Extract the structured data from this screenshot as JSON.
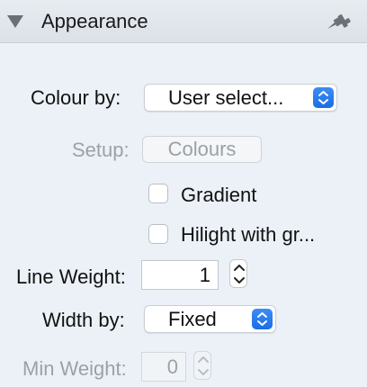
{
  "header": {
    "title": "Appearance"
  },
  "colour_by": {
    "label": "Colour by:",
    "value": "User select..."
  },
  "setup": {
    "label": "Setup:",
    "button": "Colours"
  },
  "gradient": {
    "label": "Gradient",
    "checked": false
  },
  "hilight": {
    "label": "Hilight with gr...",
    "checked": false
  },
  "line_weight": {
    "label": "Line Weight:",
    "value": "1"
  },
  "width_by": {
    "label": "Width by:",
    "value": "Fixed"
  },
  "min_weight": {
    "label": "Min Weight:",
    "value": "0"
  },
  "colors": {
    "accent": "#1a6de6",
    "disabled_text": "#9aa1a8",
    "background": "#ebf1f7"
  }
}
